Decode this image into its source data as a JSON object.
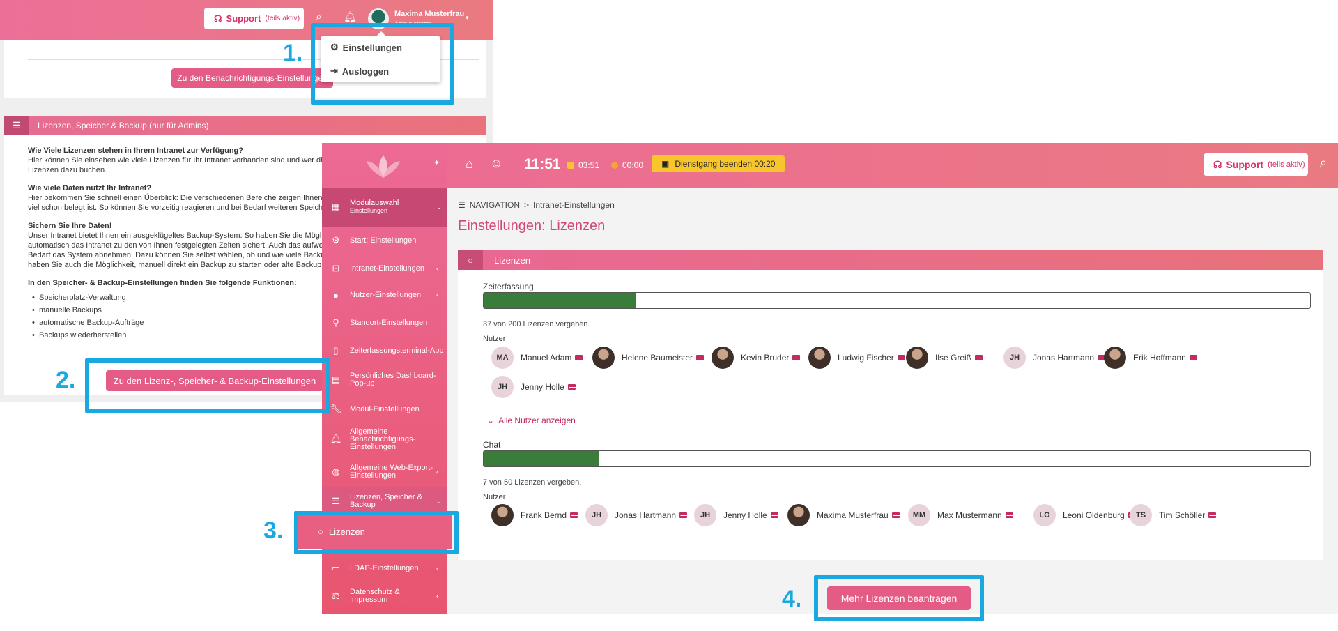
{
  "bg": {
    "support": {
      "label": "Support",
      "sub": "(teils aktiv)"
    },
    "user": {
      "name": "Maxima Musterfrau",
      "role": "Administrator"
    },
    "notif_button": "Zu den Benachrichtigungs-Einstellungen",
    "dropdown": {
      "settings": "Einstellungen",
      "logout": "Ausloggen"
    },
    "section_title": "Lizenzen, Speicher & Backup (nur für Admins)",
    "text": {
      "q1": "Wie Viele Lizenzen stehen in Ihrem Intranet zur Verfügung?",
      "a1a": "Hier können Sie einsehen wie viele Lizenzen für Ihr Intranet vorhanden sind und wer dies",
      "a1b": "Lizenzen dazu buchen.",
      "q2": "Wie viele Daten nutzt Ihr Intranet?",
      "a2a": "Hier bekommen Sie schnell einen Überblick: Die verschiedenen Bereiche zeigen Ihnen an",
      "a2b": "viel schon belegt ist. So können Sie vorzeitig reagieren und bei Bedarf weiteren Speicher",
      "q3": "Sichern Sie Ihre Daten!",
      "a3a": "Unser Intranet bietet Ihnen ein ausgeklügeltes Backup-System. So haben Sie die Möglich",
      "a3b": "automatisch das Intranet zu den von Ihnen festgelegten Zeiten sichert. Auch das aufwen",
      "a3c": "Bedarf das System abnehmen. Dazu können Sie selbst wählen, ob und wie viele Backups",
      "a3d": "haben Sie auch die Möglichkeit, manuell direkt ein Backup zu starten oder alte Backups w",
      "q4": "In den Speicher- & Backup-Einstellungen finden Sie folgende Funktionen:"
    },
    "bullets": [
      "Speicherplatz-Verwaltung",
      "manuelle Backups",
      "automatische Backup-Aufträge",
      "Backups wiederherstellen"
    ],
    "backup_button": "Zu den Lizenz-, Speicher- & Backup-Einstellungen"
  },
  "annotations": [
    "1.",
    "2.",
    "3.",
    "4."
  ],
  "main": {
    "sidebar": {
      "module": {
        "title": "Modulauswahl",
        "sub": "Einstellungen"
      },
      "items": [
        {
          "label": "Start: Einstellungen",
          "icon": "gear-icon"
        },
        {
          "label": "Intranet-Einstellungen",
          "icon": "intranet-icon"
        },
        {
          "label": "Nutzer-Einstellungen",
          "icon": "user-icon"
        },
        {
          "label": "Standort-Einstellungen",
          "icon": "location-icon"
        },
        {
          "label": "Zeiterfassungsterminal-App",
          "icon": "terminal-icon"
        },
        {
          "label": "Persönliches Dashboard-Pop-up",
          "icon": "dashboard-icon"
        },
        {
          "label": "Modul-Einstellungen",
          "icon": "wrench-icon"
        },
        {
          "label": "Allgemeine Benachrichtigungs-Einstellungen",
          "icon": "bell-icon"
        },
        {
          "label": "Allgemeine Web-Export-Einstellungen",
          "icon": "globe-icon"
        },
        {
          "label": "Lizenzen, Speicher & Backup",
          "icon": "list-icon"
        },
        {
          "label": "LDAP-Einstellungen",
          "icon": "ldap-icon"
        },
        {
          "label": "Datenschutz & Impressum",
          "icon": "scale-icon"
        }
      ],
      "sub_item": "Lizenzen"
    },
    "topbar": {
      "clock": "11:51",
      "timer1": "03:51",
      "timer2": "00:00",
      "end_shift": "Dienstgang beenden 00:20",
      "support": {
        "label": "Support",
        "sub": "(teils aktiv)"
      }
    },
    "breadcrumb": {
      "nav": "NAVIGATION",
      "sep": ">",
      "current": "Intranet-Einstellungen"
    },
    "page_title": "Einstellungen: Lizenzen",
    "card_title": "Lizenzen",
    "time": {
      "label": "Zeiterfassung",
      "used": 37,
      "total": 200,
      "text": "37 von 200 Lizenzen vergeben.",
      "users_label": "Nutzer",
      "users": [
        {
          "initials": "MA",
          "name": "Manuel Adam",
          "photo": false
        },
        {
          "initials": "",
          "name": "Helene Baumeister",
          "photo": true
        },
        {
          "initials": "",
          "name": "Kevin Bruder",
          "photo": true
        },
        {
          "initials": "",
          "name": "Ludwig Fischer",
          "photo": true
        },
        {
          "initials": "",
          "name": "Ilse Greiß",
          "photo": true
        },
        {
          "initials": "JH",
          "name": "Jonas Hartmann",
          "photo": false
        },
        {
          "initials": "",
          "name": "Erik Hoffmann",
          "photo": true
        },
        {
          "initials": "JH",
          "name": "Jenny Holle",
          "photo": false
        }
      ],
      "show_all": "Alle Nutzer anzeigen"
    },
    "chat": {
      "label": "Chat",
      "used": 7,
      "total": 50,
      "text": "7 von 50 Lizenzen vergeben.",
      "users_label": "Nutzer",
      "users": [
        {
          "initials": "",
          "name": "Frank Bernd",
          "photo": true
        },
        {
          "initials": "JH",
          "name": "Jonas Hartmann",
          "photo": false
        },
        {
          "initials": "JH",
          "name": "Jenny Holle",
          "photo": false
        },
        {
          "initials": "",
          "name": "Maxima Musterfrau",
          "photo": true
        },
        {
          "initials": "MM",
          "name": "Max Mustermann",
          "photo": false
        },
        {
          "initials": "LO",
          "name": "Leoni Oldenburg",
          "photo": false
        },
        {
          "initials": "TS",
          "name": "Tim Schöller",
          "photo": false
        }
      ]
    },
    "more_button": "Mehr Lizenzen beantragen"
  },
  "colors": {
    "pink": "#ec6a95",
    "accent": "#1aa8e0",
    "bar": "#3a7d3a"
  }
}
